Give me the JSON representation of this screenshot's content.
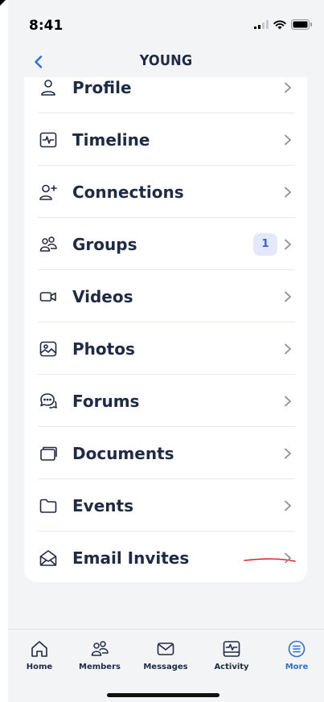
{
  "status": {
    "time": "8:41"
  },
  "nav": {
    "title": "YOUNG"
  },
  "menu": [
    {
      "label": "Profile",
      "icon": "profile-icon"
    },
    {
      "label": "Timeline",
      "icon": "timeline-icon"
    },
    {
      "label": "Connections",
      "icon": "connections-icon"
    },
    {
      "label": "Groups",
      "icon": "groups-icon",
      "badge": "1"
    },
    {
      "label": "Videos",
      "icon": "video-camera-icon"
    },
    {
      "label": "Photos",
      "icon": "photo-icon"
    },
    {
      "label": "Forums",
      "icon": "chat-bubbles-icon"
    },
    {
      "label": "Documents",
      "icon": "documents-icon"
    },
    {
      "label": "Events",
      "icon": "folder-icon"
    },
    {
      "label": "Email Invites",
      "icon": "envelope-open-icon"
    }
  ],
  "tabs": [
    {
      "label": "Home",
      "icon": "home-icon"
    },
    {
      "label": "Members",
      "icon": "members-icon"
    },
    {
      "label": "Messages",
      "icon": "messages-icon"
    },
    {
      "label": "Activity",
      "icon": "activity-icon"
    },
    {
      "label": "More",
      "icon": "more-icon",
      "active": true
    }
  ],
  "colors": {
    "text": "#1f2a44",
    "accent": "#2f6fdb",
    "badge_bg": "#e3e8fb",
    "annotation": "#e02020"
  }
}
